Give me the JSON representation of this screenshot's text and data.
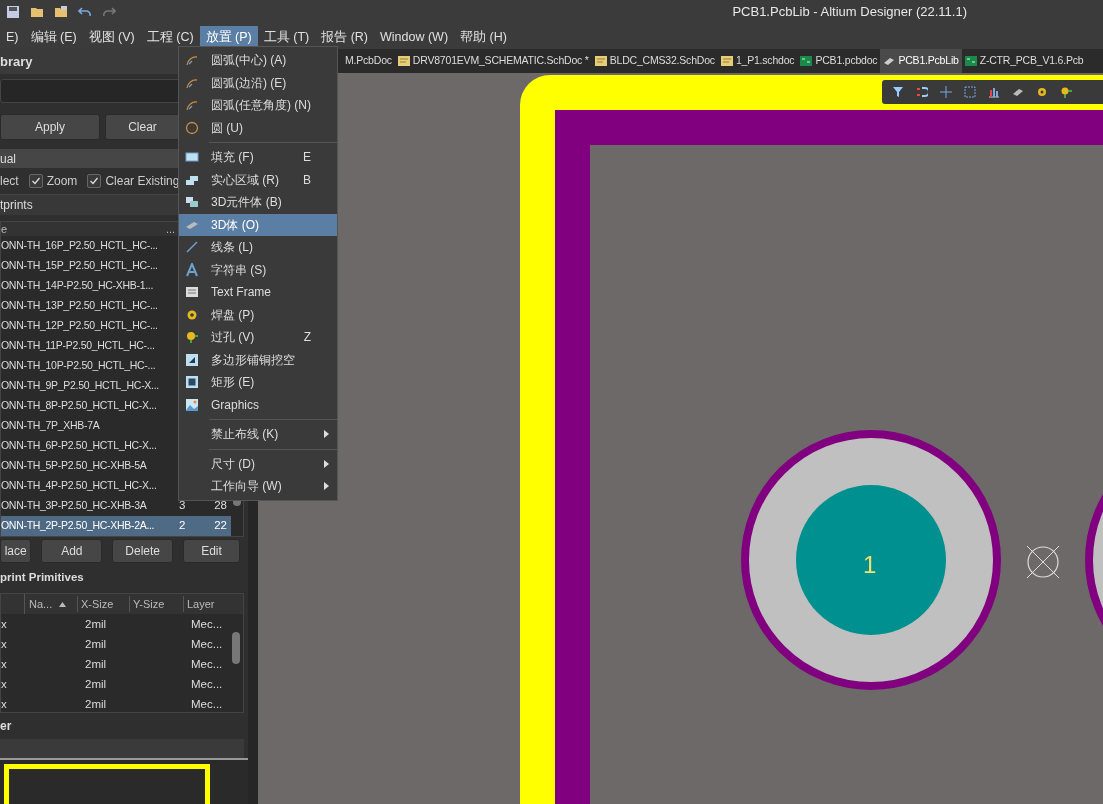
{
  "window": {
    "title": "PCB1.PcbLib - Altium Designer (22.11.1)"
  },
  "menu_bar": [
    {
      "label": "E)",
      "selected": false
    },
    {
      "label": "编辑 (E)",
      "selected": false
    },
    {
      "label": "视图 (V)",
      "selected": false
    },
    {
      "label": "工程 (C)",
      "selected": false
    },
    {
      "label": "放置 (P)",
      "selected": true
    },
    {
      "label": "工具 (T)",
      "selected": false
    },
    {
      "label": "报告 (R)",
      "selected": false
    },
    {
      "label": "Window (W)",
      "selected": false
    },
    {
      "label": "帮助 (H)",
      "selected": false
    }
  ],
  "document_tabs": [
    {
      "label": "M.PcbDoc",
      "selected": false
    },
    {
      "label": "DRV8701EVM_SCHEMATIC.SchDoc *",
      "selected": false
    },
    {
      "label": "BLDC_CMS32.SchDoc",
      "selected": false
    },
    {
      "label": "1_P1.schdoc",
      "selected": false
    },
    {
      "label": "PCB1.pcbdoc",
      "selected": false
    },
    {
      "label": "PCB1.PcbLib",
      "selected": true
    },
    {
      "label": "Z-CTR_PCB_V1.6.Pcb",
      "selected": false
    }
  ],
  "place_menu": [
    {
      "kind": "item",
      "label": "圆弧(中心) (A)",
      "submenu": false,
      "selected": false
    },
    {
      "kind": "item",
      "label": "圆弧(边沿) (E)",
      "submenu": false,
      "selected": false
    },
    {
      "kind": "item",
      "label": "圆弧(任意角度) (N)",
      "submenu": false,
      "selected": false
    },
    {
      "kind": "item",
      "label": "圆 (U)",
      "submenu": false,
      "selected": false
    },
    {
      "kind": "separator"
    },
    {
      "kind": "item",
      "label": "填充 (F)",
      "shortcut": "E",
      "submenu": false,
      "selected": false
    },
    {
      "kind": "item",
      "label": "实心区域 (R)",
      "shortcut": "B",
      "submenu": false,
      "selected": false
    },
    {
      "kind": "item",
      "label": "3D元件体 (B)",
      "submenu": false,
      "selected": false
    },
    {
      "kind": "item",
      "label": "3D体 (O)",
      "submenu": false,
      "selected": true
    },
    {
      "kind": "item",
      "label": "线条 (L)",
      "submenu": false,
      "selected": false
    },
    {
      "kind": "item",
      "label": "字符串 (S)",
      "submenu": false,
      "selected": false
    },
    {
      "kind": "item",
      "label": "Text Frame",
      "submenu": false,
      "selected": false
    },
    {
      "kind": "item",
      "label": "焊盘 (P)",
      "submenu": false,
      "selected": false
    },
    {
      "kind": "item",
      "label": "过孔 (V)",
      "shortcut": "Z",
      "submenu": false,
      "selected": false
    },
    {
      "kind": "item",
      "label": "多边形铺铜挖空",
      "submenu": false,
      "selected": false
    },
    {
      "kind": "item",
      "label": "矩形 (E)",
      "submenu": false,
      "selected": false
    },
    {
      "kind": "item",
      "label": "Graphics",
      "submenu": false,
      "selected": false
    },
    {
      "kind": "separator"
    },
    {
      "kind": "item",
      "label": "禁止布线 (K)",
      "submenu": true,
      "selected": false
    },
    {
      "kind": "separator"
    },
    {
      "kind": "item",
      "label": "尺寸 (D)",
      "submenu": true,
      "selected": false
    },
    {
      "kind": "item",
      "label": "工作向导 (W)",
      "submenu": true,
      "selected": false
    }
  ],
  "library_panel": {
    "title": "brary",
    "buttons": [
      "Apply",
      "Clear"
    ],
    "mask_label": "ual",
    "options": [
      {
        "label": "lect"
      },
      {
        "label": "Zoom",
        "checked": true
      },
      {
        "label": "Clear Existing",
        "checked": true
      }
    ]
  },
  "footprints": {
    "title": "tprints",
    "columns": [
      "e",
      "..."
    ],
    "rows": [
      {
        "name": "ONN-TH_16P_P2.50_HCTL_HC-...",
        "selected": false
      },
      {
        "name": "ONN-TH_15P_P2.50_HCTL_HC-...",
        "selected": false
      },
      {
        "name": "ONN-TH_14P-P2.50_HC-XHB-1...",
        "selected": false
      },
      {
        "name": "ONN-TH_13P_P2.50_HCTL_HC-...",
        "selected": false
      },
      {
        "name": "ONN-TH_12P_P2.50_HCTL_HC-...",
        "selected": false
      },
      {
        "name": "ONN-TH_11P-P2.50_HCTL_HC-...",
        "selected": false
      },
      {
        "name": "ONN-TH_10P-P2.50_HCTL_HC-...",
        "selected": false
      },
      {
        "name": "ONN-TH_9P_P2.50_HCTL_HC-X...",
        "selected": false
      },
      {
        "name": "ONN-TH_8P-P2.50_HCTL_HC-X...",
        "selected": false
      },
      {
        "name": "ONN-TH_7P_XHB-7A",
        "selected": false
      },
      {
        "name": "ONN-TH_6P-P2.50_HCTL_HC-X...",
        "selected": false
      },
      {
        "name": "ONN-TH_5P-P2.50_HC-XHB-5A",
        "selected": false
      },
      {
        "name": "ONN-TH_4P-P2.50_HCTL_HC-X...",
        "selected": false
      },
      {
        "name": "ONN-TH_3P-P2.50_HC-XHB-3A",
        "pads": "3",
        "primitives": "28",
        "selected": false
      },
      {
        "name": "ONN-TH_2P-P2.50_HC-XHB-2A...",
        "pads": "2",
        "primitives": "22",
        "selected": true
      }
    ],
    "buttons": [
      "lace",
      "Add",
      "Delete",
      "Edit"
    ]
  },
  "primitives": {
    "title": "print Primitives",
    "columns": [
      "Na...",
      "X-Size",
      "Y-Size",
      "Layer"
    ],
    "rows": [
      {
        "type": "x",
        "x_size": "2mil",
        "layer": "Mec..."
      },
      {
        "type": "x",
        "x_size": "2mil",
        "layer": "Mec..."
      },
      {
        "type": "x",
        "x_size": "2mil",
        "layer": "Mec..."
      },
      {
        "type": "x",
        "x_size": "2mil",
        "layer": "Mec..."
      },
      {
        "type": "x",
        "x_size": "2mil",
        "layer": "Mec..."
      }
    ]
  },
  "viewer": {
    "title": "er"
  },
  "canvas": {
    "pad_number": "1"
  }
}
